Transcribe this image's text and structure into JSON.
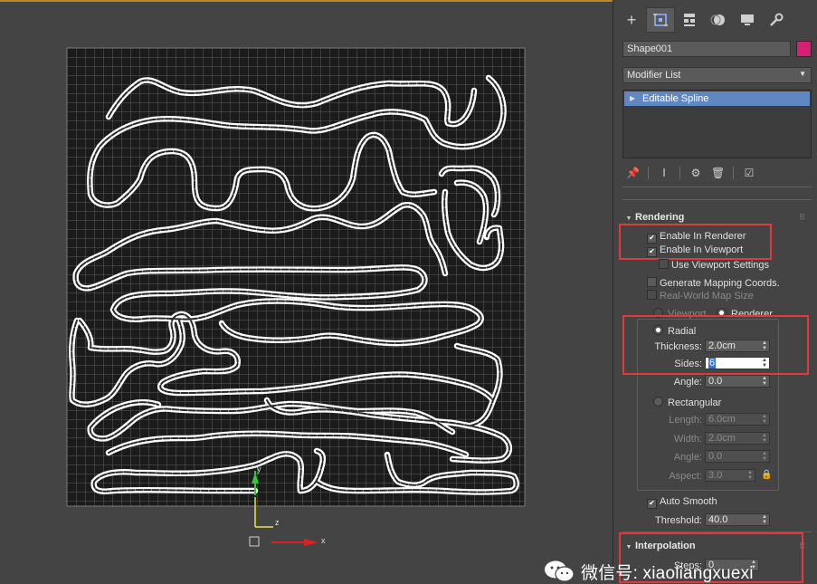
{
  "command_panel": {
    "tabs": [
      {
        "id": "create",
        "icon": "plus-icon",
        "glyph": "+"
      },
      {
        "id": "modify",
        "icon": "modify-icon",
        "glyph": "⊡"
      },
      {
        "id": "hierarchy",
        "icon": "hierarchy-icon",
        "glyph": "⊤"
      },
      {
        "id": "motion",
        "icon": "motion-icon",
        "glyph": "◐"
      },
      {
        "id": "display",
        "icon": "display-icon",
        "glyph": "▬"
      },
      {
        "id": "utilities",
        "icon": "wrench-icon",
        "glyph": "🔧"
      }
    ],
    "active_tab": "modify",
    "object_name": "Shape001",
    "object_color": "#d81f73",
    "modifier_list": "Modifier List",
    "stack_items": [
      "Editable Spline"
    ]
  },
  "rendering": {
    "title": "Rendering",
    "enable_in_renderer": "Enable In Renderer",
    "enable_in_viewport": "Enable In Viewport",
    "use_viewport_settings": "Use Viewport Settings",
    "generate_mapping": "Generate Mapping Coords.",
    "real_world_map_size": "Real-World Map Size",
    "viewport": "Viewport",
    "renderer": "Renderer",
    "radial": "Radial",
    "thickness_label": "Thickness:",
    "thickness_value": "2.0cm",
    "sides_label": "Sides:",
    "sides_value": "6",
    "angle_label": "Angle:",
    "angle_value": "0.0",
    "rectangular": "Rectangular",
    "length_label": "Length:",
    "length_value": "6.0cm",
    "width_label": "Width:",
    "width_value": "2.0cm",
    "rect_angle_label": "Angle:",
    "rect_angle_value": "0.0",
    "aspect_label": "Aspect:",
    "aspect_value": "3.0",
    "auto_smooth": "Auto Smooth",
    "threshold_label": "Threshold:",
    "threshold_value": "40.0"
  },
  "interpolation": {
    "title": "Interpolation",
    "steps_label": "Steps:",
    "steps_value": "0"
  },
  "viewport": {
    "axis_y": "y",
    "axis_x": "x",
    "axis_z": "z"
  },
  "watermark": {
    "text": "微信号: xiaoliangxuexi"
  }
}
